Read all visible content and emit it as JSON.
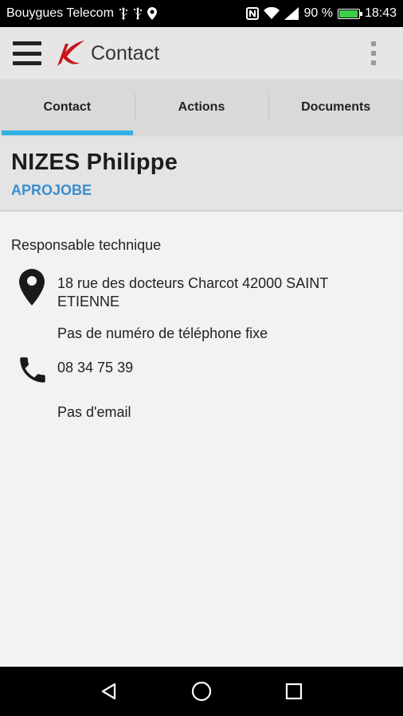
{
  "status_bar": {
    "carrier": "Bouygues Telecom",
    "battery": "90 %",
    "battery_level": 0.9,
    "time": "18:43",
    "icons": [
      "usb-icon",
      "usb-icon",
      "location-icon",
      "nfc-icon",
      "wifi-icon",
      "signal-icon",
      "battery-icon"
    ]
  },
  "app_bar": {
    "title": "Contact",
    "menu_icon": "hamburger-menu-icon",
    "overflow_icon": "more-vert-icon",
    "brand_color": "#c8161d"
  },
  "tabs": [
    {
      "label": "Contact",
      "active": true
    },
    {
      "label": "Actions",
      "active": false
    },
    {
      "label": "Documents",
      "active": false
    }
  ],
  "contact": {
    "name": "NIZES Philippe",
    "company": "APROJOBE",
    "role": "Responsable technique",
    "address": "18 rue des docteurs Charcot 42000 SAINT ETIENNE",
    "landline": "Pas de numéro de téléphone fixe",
    "mobile": "08 34 75 39",
    "email": "Pas d'email"
  },
  "colors": {
    "accent": "#33b0e2",
    "company": "#3a8fd0"
  },
  "nav_bar": {
    "buttons": [
      "back-icon",
      "home-icon",
      "recents-icon"
    ]
  }
}
